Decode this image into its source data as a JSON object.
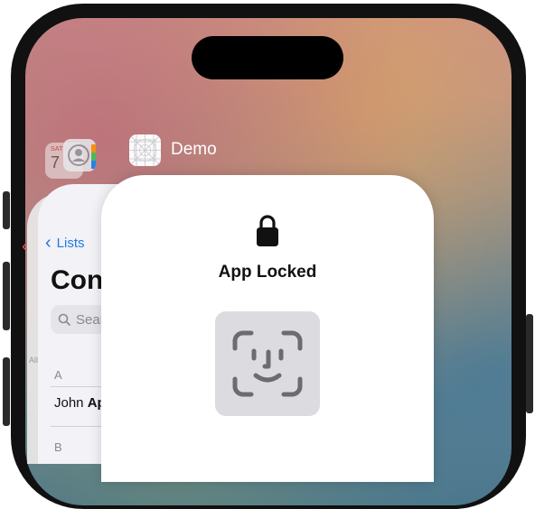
{
  "switcher": {
    "front_app": {
      "name": "Demo",
      "icon": "demo-app-grid-icon",
      "locked_title": "App Locked",
      "lock_icon": "lock-icon",
      "unlock_button_icon": "face-id-icon"
    },
    "background_app": {
      "back_label": "Lists",
      "title_partial": "Con",
      "search_placeholder_partial": "Sear",
      "small_label": "All",
      "section_a": "A",
      "contact_first": "John",
      "contact_last_partial": "Ap",
      "section_b": "B"
    },
    "stacked_icons": {
      "calendar": {
        "day": "SAT",
        "date": "7"
      },
      "contacts_icon": "contacts-icon"
    }
  },
  "colors": {
    "accent_blue": "#1f7ae0",
    "back_chevron_red": "#e0514b",
    "faceid_button_bg": "#dcdce0",
    "faceid_glyph": "#6b6b70"
  }
}
